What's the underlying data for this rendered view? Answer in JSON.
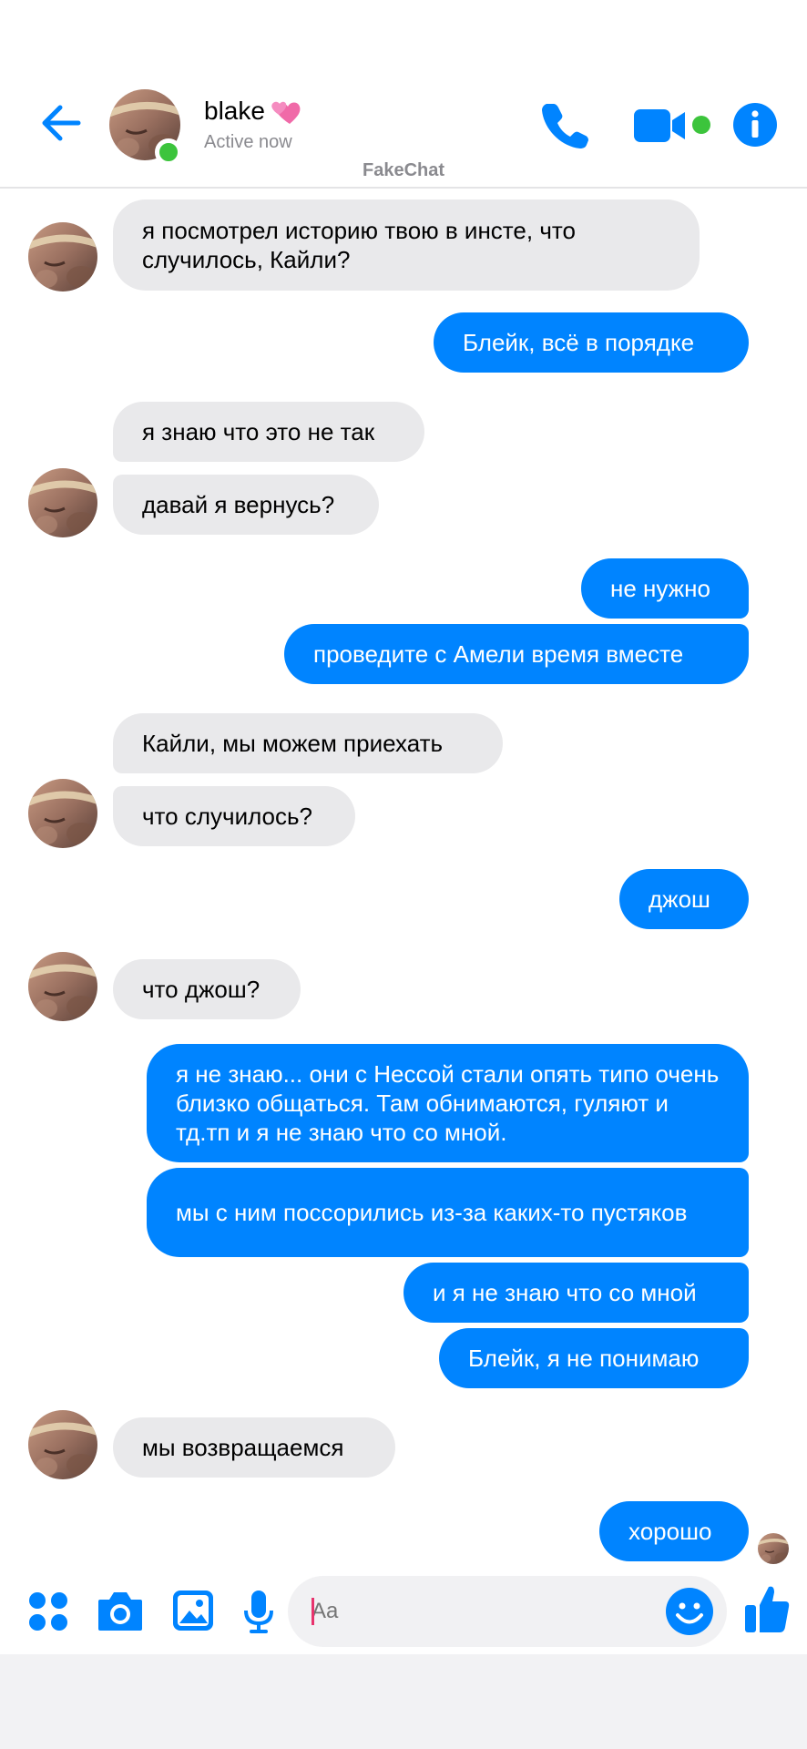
{
  "header": {
    "contact_name": "blake",
    "status": "Active now",
    "watermark": "FakeChat"
  },
  "composer": {
    "placeholder": "Aa"
  },
  "colors": {
    "accent": "#0084ff",
    "incoming_bubble": "#e9e9eb",
    "online": "#3cc43c"
  },
  "messages": [
    {
      "dir": "in",
      "text": "я посмотрел историю твою в инсте, что случилось, Кайли?"
    },
    {
      "dir": "out",
      "text": "Блейк, всё в порядке"
    },
    {
      "dir": "in",
      "text": "я знаю что это не так"
    },
    {
      "dir": "in",
      "text": "давай я вернусь?"
    },
    {
      "dir": "out",
      "text": "не нужно"
    },
    {
      "dir": "out",
      "text": "проведите с Амели время вместе"
    },
    {
      "dir": "in",
      "text": "Кайли, мы можем приехать"
    },
    {
      "dir": "in",
      "text": "что случилось?"
    },
    {
      "dir": "out",
      "text": "джош"
    },
    {
      "dir": "in",
      "text": "что джош?"
    },
    {
      "dir": "out",
      "text": "я не знаю... они с Нессой стали опять типо очень близко общаться. Там обнимаются, гуляют и тд.тп и я не знаю  что со мной."
    },
    {
      "dir": "out",
      "text": "мы с ним поссорились из-за каких-то пустяков"
    },
    {
      "dir": "out",
      "text": "и я не знаю что со мной"
    },
    {
      "dir": "out",
      "text": "Блейк, я не понимаю"
    },
    {
      "dir": "in",
      "text": "мы возвращаемся"
    },
    {
      "dir": "out",
      "text": "хорошо"
    }
  ],
  "icons": {
    "back": "arrow-left-icon",
    "call": "phone-icon",
    "video": "video-camera-icon",
    "info": "info-icon",
    "apps": "four-dots-icon",
    "camera": "camera-icon",
    "gallery": "image-icon",
    "mic": "microphone-icon",
    "emoji": "smiley-icon",
    "like": "thumbs-up-icon"
  }
}
